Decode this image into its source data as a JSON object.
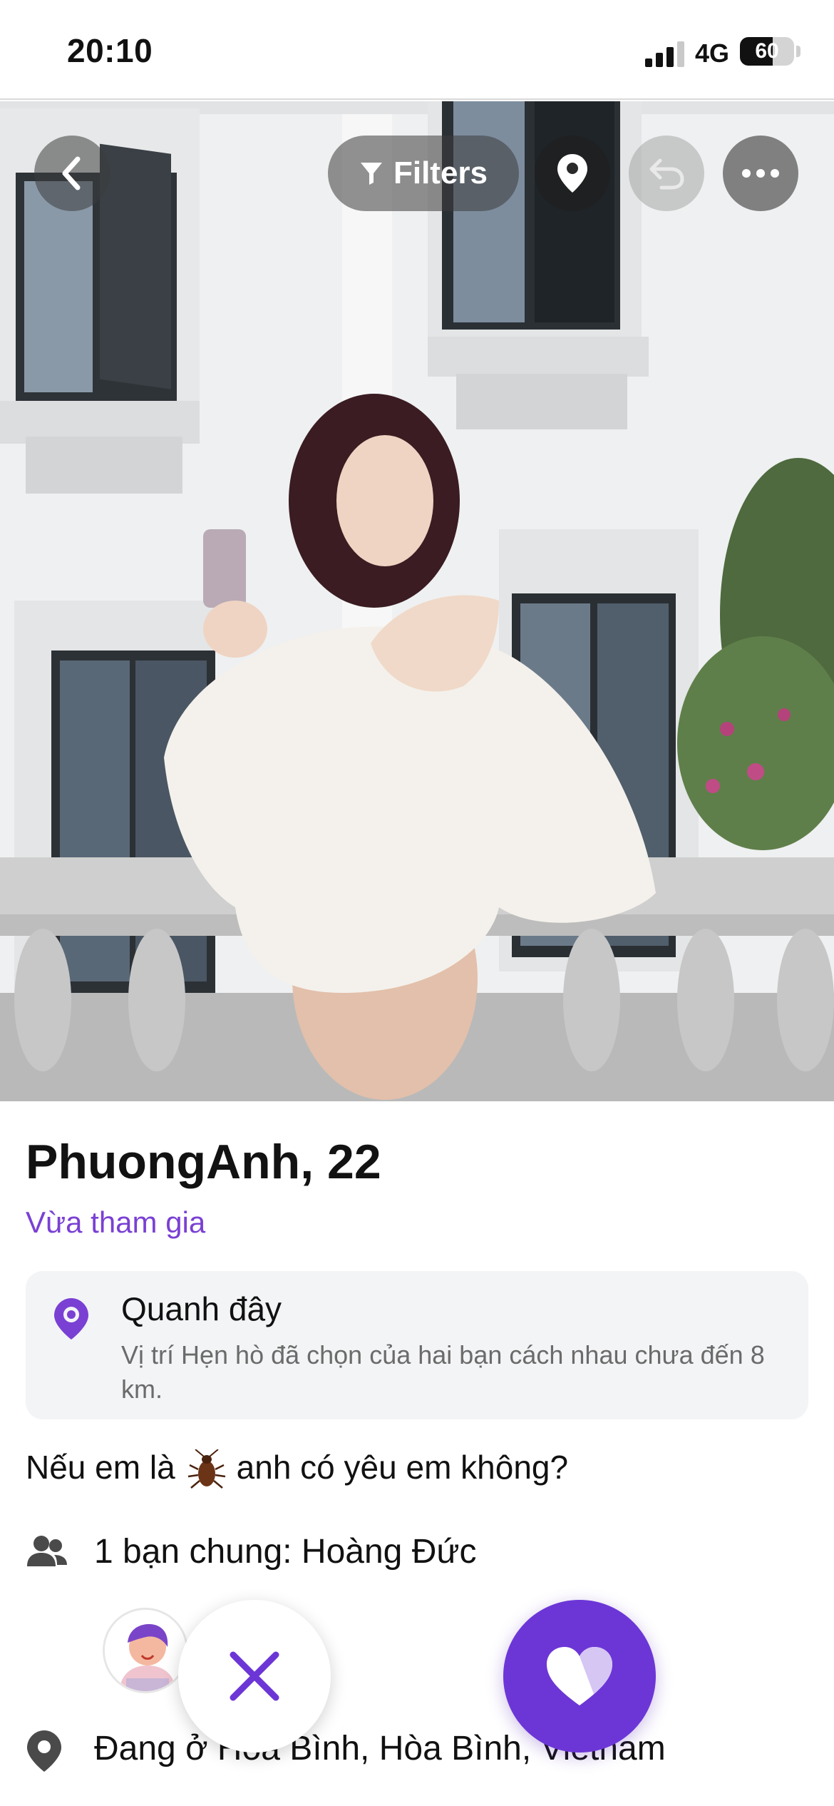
{
  "status_bar": {
    "time": "20:10",
    "network": "4G",
    "battery": "60",
    "battery_level_percent": 60
  },
  "toolbar": {
    "back_icon": "chevron-left-icon",
    "filters_label": "Filters",
    "filters_icon": "funnel-icon",
    "location_icon": "map-pin-icon",
    "undo_icon": "undo-icon",
    "more_icon": "ellipsis-icon"
  },
  "profile": {
    "name_age": "PhuongAnh, 22",
    "joined_label": "Vừa tham gia",
    "photo": "profile-photo",
    "location_card": {
      "title": "Quanh đây",
      "description": "Vị trí Hẹn hò đã chọn của hai bạn cách nhau chưa đến 8 km."
    },
    "bio_before": "Nếu em là",
    "bio_emoji": "cockroach-emoji",
    "bio_after": "anh có yêu em không?",
    "mutual_friends": "1 bạn chung: Hoàng Đức",
    "living_in": "Đang ở Hòa Bình, Hòa Bình, Vietnam"
  },
  "actions": {
    "pass_icon": "close-icon",
    "like_icon": "heart-icon"
  },
  "colors": {
    "accent": "#6c36d6",
    "joined_text": "#7a40d4",
    "card_bg": "#f3f4f6"
  }
}
